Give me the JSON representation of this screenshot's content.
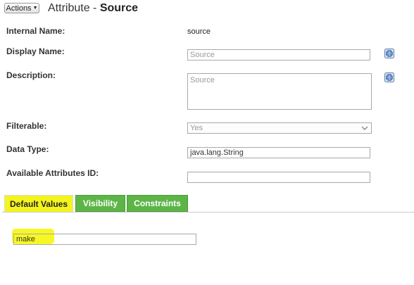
{
  "header": {
    "actions_label": "Actions",
    "title_prefix": "Attribute - ",
    "title_name": "Source"
  },
  "fields": {
    "internal_name": {
      "label": "Internal Name:",
      "value": "source"
    },
    "display_name": {
      "label": "Display Name:",
      "placeholder": "Source"
    },
    "description": {
      "label": "Description:",
      "placeholder": "Source"
    },
    "filterable": {
      "label": "Filterable:",
      "selected": "Yes"
    },
    "data_type": {
      "label": "Data Type:",
      "value": "java.lang.String"
    },
    "available_attributes_id": {
      "label": "Available Attributes ID:",
      "value": ""
    }
  },
  "tabs": [
    {
      "label": "Default Values",
      "active": true
    },
    {
      "label": "Visibility",
      "active": false
    },
    {
      "label": "Constraints",
      "active": false
    }
  ],
  "default_values": {
    "value": "make"
  },
  "colors": {
    "tab_active": "#f4f41e",
    "tab_green": "#5db548",
    "highlight": "#f6f600"
  }
}
